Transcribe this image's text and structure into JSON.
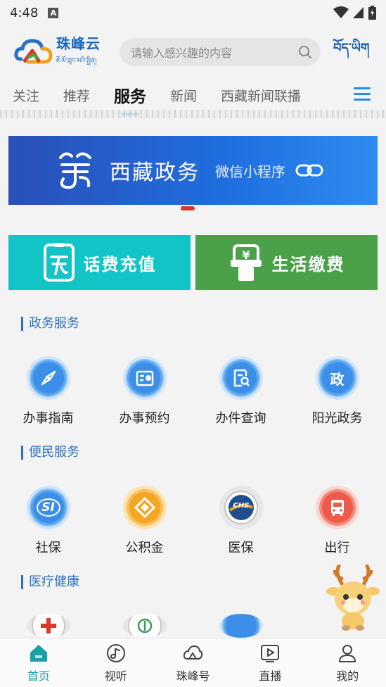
{
  "status_bar": {
    "time": "4:48",
    "notification_letter": "A"
  },
  "header": {
    "app_name": "珠峰云",
    "app_name_tibetan": "ཇོ་མོ་གླང་མའི་སྤྲིན།",
    "search_placeholder": "请输入感兴趣的内容",
    "language_toggle": "བོད་ཡིག"
  },
  "tabs": [
    {
      "label": "关注",
      "active": false
    },
    {
      "label": "推荐",
      "active": false
    },
    {
      "label": "服务",
      "active": true
    },
    {
      "label": "新闻",
      "active": false
    },
    {
      "label": "西藏新闻联播",
      "active": false
    }
  ],
  "banner": {
    "title": "西藏政务",
    "subtitle": "微信小程序"
  },
  "tiles": {
    "recharge": "话费充值",
    "bill": "生活缴费"
  },
  "sections": {
    "gov": {
      "title": "政务服务",
      "items": [
        {
          "label": "办事指南",
          "icon": "compass-icon"
        },
        {
          "label": "办事预约",
          "icon": "calendar-clock-icon"
        },
        {
          "label": "办件查询",
          "icon": "document-search-icon"
        },
        {
          "label": "阳光政务",
          "icon": "gov-badge-icon",
          "badge_text": "政"
        }
      ]
    },
    "citizen": {
      "title": "便民服务",
      "items": [
        {
          "label": "社保",
          "icon": "social-insurance-icon",
          "badge_text": "SI"
        },
        {
          "label": "公积金",
          "icon": "housing-fund-icon"
        },
        {
          "label": "医保",
          "icon": "medical-insurance-icon",
          "badge_text": "CHS"
        },
        {
          "label": "出行",
          "icon": "bus-icon"
        }
      ]
    },
    "health": {
      "title": "医疗健康"
    }
  },
  "bottom_nav": [
    {
      "label": "首页",
      "icon": "home-icon",
      "active": true
    },
    {
      "label": "视听",
      "icon": "music-note-icon",
      "active": false
    },
    {
      "label": "珠峰号",
      "icon": "cloud-icon",
      "active": false
    },
    {
      "label": "直播",
      "icon": "play-icon",
      "active": false
    },
    {
      "label": "我的",
      "icon": "person-icon",
      "active": false
    }
  ],
  "colors": {
    "accent": "#1a6bbf",
    "recharge_tile": "#12c4c6",
    "bill_tile": "#4aa14a",
    "banner": "#1f6fe0",
    "nav_active": "#1aa0a8"
  }
}
